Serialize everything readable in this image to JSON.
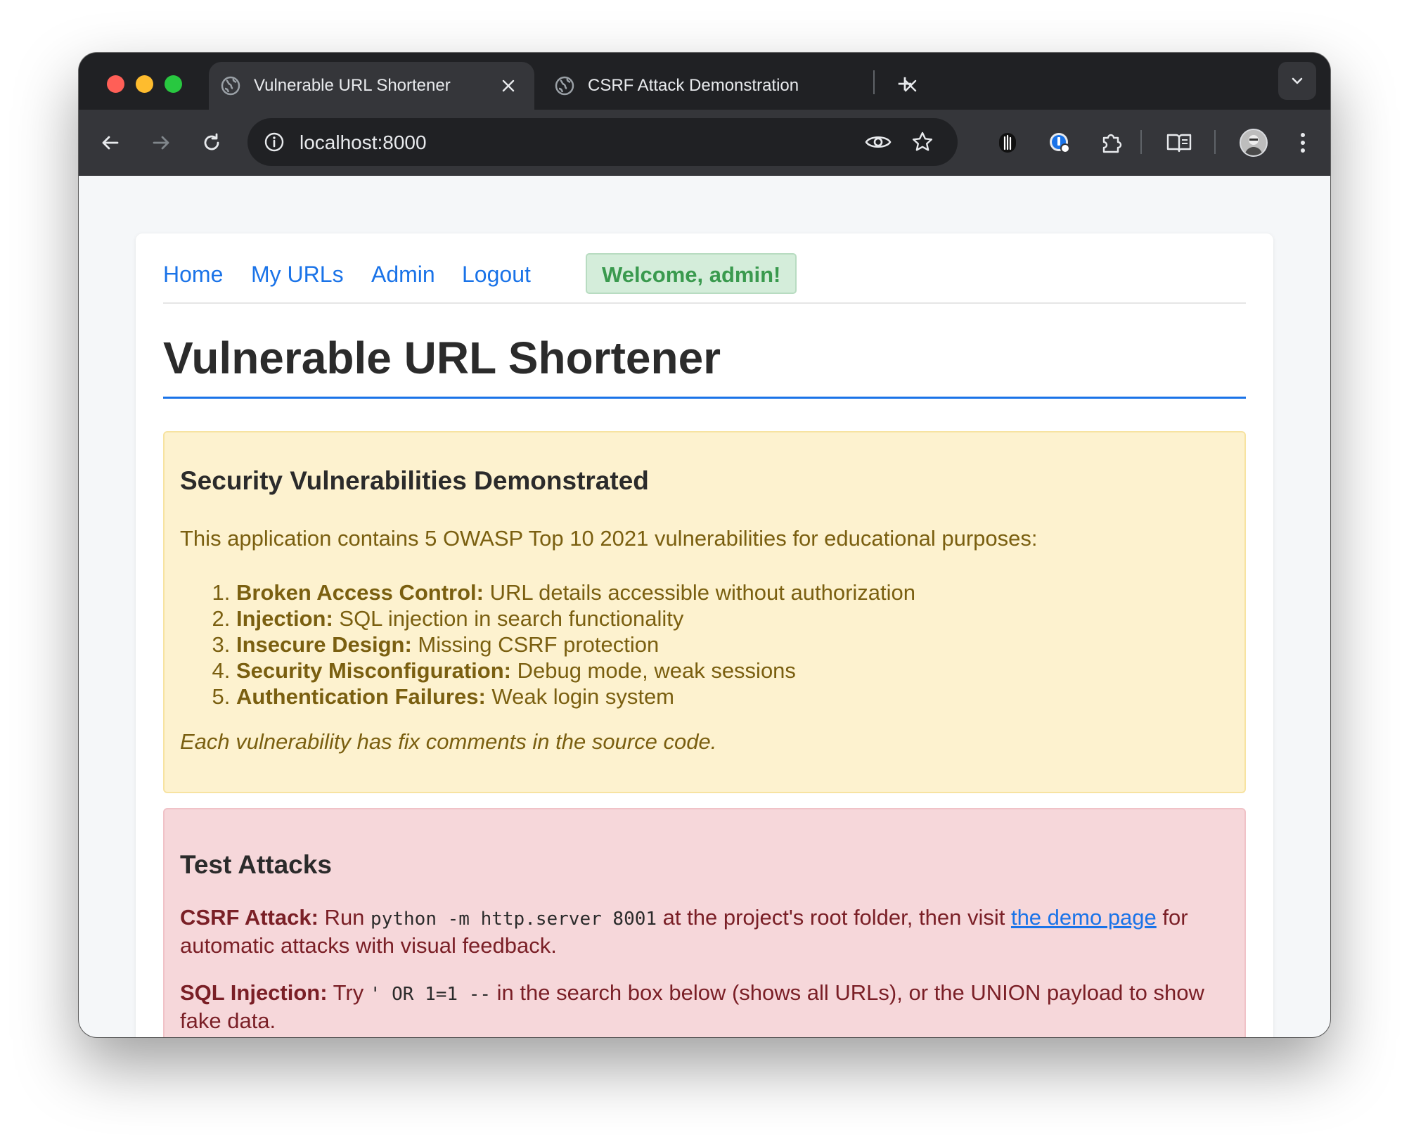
{
  "browser": {
    "tabs": [
      {
        "title": "Vulnerable URL Shortener",
        "active": true
      },
      {
        "title": "CSRF Attack Demonstration",
        "active": false
      }
    ],
    "new_tab_label": "+",
    "address": "localhost:8000"
  },
  "nav": {
    "links": [
      "Home",
      "My URLs",
      "Admin",
      "Logout"
    ],
    "welcome": "Welcome, admin!"
  },
  "page": {
    "title": "Vulnerable URL Shortener"
  },
  "vulns": {
    "heading": "Security Vulnerabilities Demonstrated",
    "intro": "This application contains 5 OWASP Top 10 2021 vulnerabilities for educational purposes:",
    "items": [
      {
        "name": "Broken Access Control:",
        "desc": " URL details accessible without authorization"
      },
      {
        "name": "Injection:",
        "desc": " SQL injection in search functionality"
      },
      {
        "name": "Insecure Design:",
        "desc": " Missing CSRF protection"
      },
      {
        "name": "Security Misconfiguration:",
        "desc": " Debug mode, weak sessions"
      },
      {
        "name": "Authentication Failures:",
        "desc": " Weak login system"
      }
    ],
    "note": "Each vulnerability has fix comments in the source code."
  },
  "attacks": {
    "heading": "Test Attacks",
    "csrf": {
      "label": "CSRF Attack:",
      "pre": " Run ",
      "code": "python -m http.server 8001",
      "mid": " at the project's root folder, then visit ",
      "link": "the demo page",
      "post": " for automatic attacks with visual feedback."
    },
    "sql": {
      "label": "SQL Injection:",
      "pre": " Try ",
      "code": "' OR 1=1 --",
      "post": " in the search box below (shows all URLs), or the UNION payload to show fake data."
    }
  },
  "colors": {
    "accent": "#1a73e8",
    "warning_bg": "#fdf2cf",
    "danger_bg": "#f6d7da",
    "success_bg": "#d4edda"
  }
}
